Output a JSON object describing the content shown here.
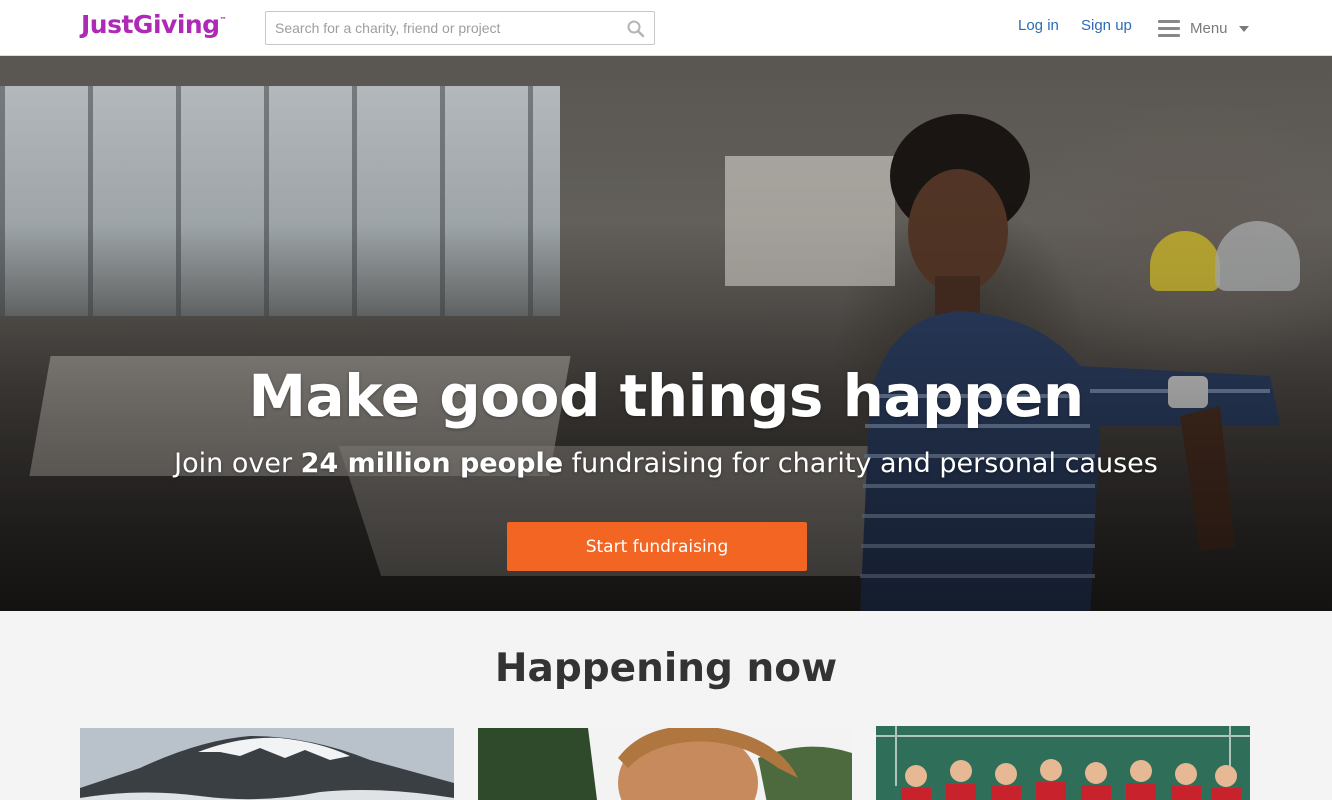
{
  "header": {
    "logo": "JustGiving",
    "logo_tm": "™",
    "search_placeholder": "Search for a charity, friend or project",
    "login_label": "Log in",
    "signup_label": "Sign up",
    "menu_label": "Menu"
  },
  "hero": {
    "title": "Make good things happen",
    "subtitle_prefix": "Join over ",
    "subtitle_bold": "24 million people",
    "subtitle_suffix": " fundraising for charity and personal causes",
    "cta_label": "Start fundraising"
  },
  "happening": {
    "title": "Happening now",
    "cards": [
      {
        "subject": "mountain photo"
      },
      {
        "subject": "runner photo"
      },
      {
        "subject": "team celebration photo"
      }
    ]
  },
  "colors": {
    "brand": "#ad29b6",
    "link": "#2b6bb5",
    "cta": "#f26522"
  }
}
